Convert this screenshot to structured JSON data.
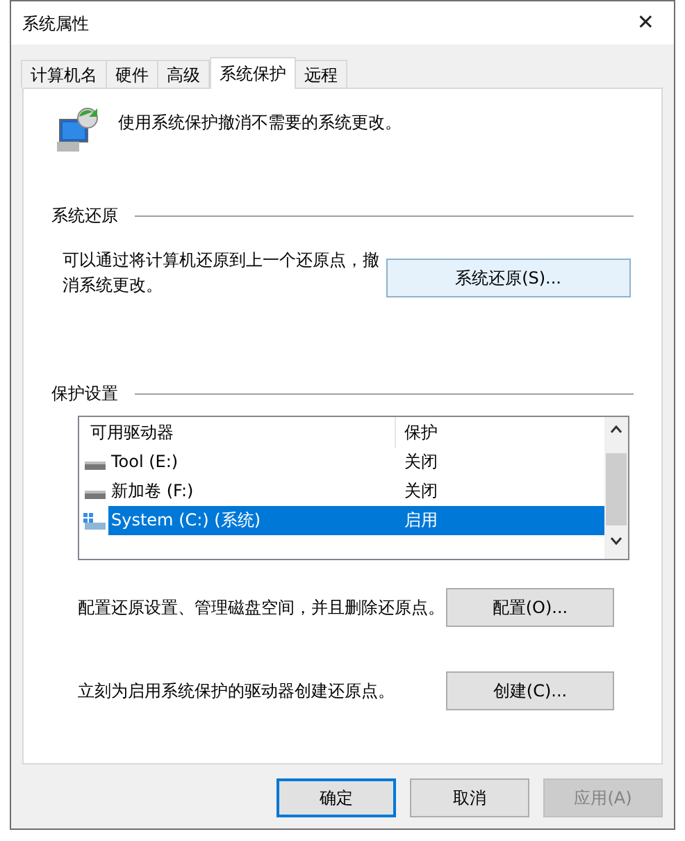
{
  "window": {
    "title": "系统属性",
    "close": "✕"
  },
  "tabs": [
    {
      "label": "计算机名",
      "selected": false
    },
    {
      "label": "硬件",
      "selected": false
    },
    {
      "label": "高级",
      "selected": false
    },
    {
      "label": "系统保护",
      "selected": true
    },
    {
      "label": "远程",
      "selected": false
    }
  ],
  "intro": "使用系统保护撤消不需要的系统更改。",
  "system_restore": {
    "heading": "系统还原",
    "description": "可以通过将计算机还原到上一个还原点，撤消系统更改。",
    "button": "系统还原(S)..."
  },
  "protection": {
    "heading": "保护设置",
    "columns": [
      "可用驱动器",
      "保护"
    ],
    "rows": [
      {
        "kind": "drive",
        "drive": "Tool (E:)",
        "status": "关闭",
        "selected": false
      },
      {
        "kind": "drive",
        "drive": "新加卷 (F:)",
        "status": "关闭",
        "selected": false
      },
      {
        "kind": "system",
        "drive": "System (C:) (系统)",
        "status": "启用",
        "selected": true
      }
    ],
    "configure": {
      "description": "配置还原设置、管理磁盘空间，并且删除还原点。",
      "button": "配置(O)..."
    },
    "create": {
      "description": "立刻为启用系统保护的驱动器创建还原点。",
      "button": "创建(C)..."
    }
  },
  "buttons": [
    {
      "label": "确定",
      "default": true,
      "disabled": false
    },
    {
      "label": "取消",
      "default": false,
      "disabled": false
    },
    {
      "label": "应用(A)",
      "default": false,
      "disabled": true
    }
  ]
}
